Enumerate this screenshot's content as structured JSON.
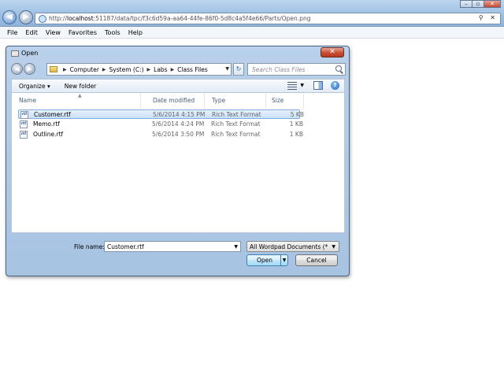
{
  "browser": {
    "url_prefix": "http://",
    "url_host": "localhost",
    "url_rest": ":51187/data/tpc/f3c6d59a-aa64-44fe-86f0-5d8c4a5f4e66/Parts/Open.png",
    "tools_glyphs": "⚲ ✕",
    "window_buttons": [
      "–",
      "▫",
      "✕"
    ]
  },
  "menubar": {
    "items": [
      "File",
      "Edit",
      "View",
      "Favorites",
      "Tools",
      "Help"
    ]
  },
  "dialog": {
    "title": "Open",
    "close_glyph": "✕",
    "breadcrumb": [
      "Computer",
      "System (C:)",
      "Labs",
      "Class Files"
    ],
    "search_placeholder": "Search Class Files",
    "toolbar": {
      "organize": "Organize ▾",
      "new_folder": "New folder"
    },
    "columns": [
      "Name",
      "Date modified",
      "Type",
      "Size"
    ],
    "files": [
      {
        "name": "Customer.rtf",
        "date": "5/6/2014 4:15 PM",
        "type": "Rich Text Format",
        "size": "5 KB",
        "selected": true
      },
      {
        "name": "Memo.rtf",
        "date": "5/6/2014 4:24 PM",
        "type": "Rich Text Format",
        "size": "1 KB",
        "selected": false
      },
      {
        "name": "Outline.rtf",
        "date": "5/6/2014 3:50 PM",
        "type": "Rich Text Format",
        "size": "1 KB",
        "selected": false
      }
    ],
    "file_name_label": "File name:",
    "file_name_value": "Customer.rtf",
    "file_type_filter": "All Wordpad Documents (*.rtf,",
    "open_button": "Open",
    "cancel_button": "Cancel"
  }
}
